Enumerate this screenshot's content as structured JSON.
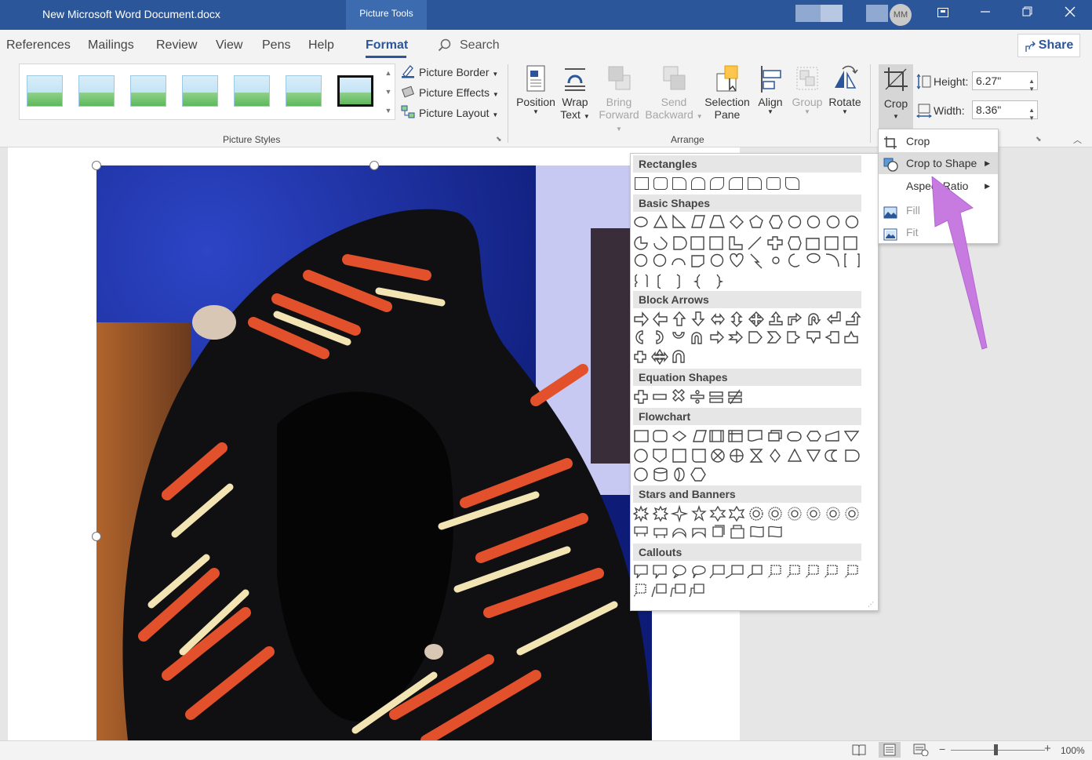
{
  "title_bar": {
    "doc_title": "New Microsoft Word Document.docx",
    "context_tab": "Picture Tools",
    "user_initials": "MM",
    "colors": {
      "bar": "#2b579a"
    }
  },
  "menu": {
    "tabs": [
      "References",
      "Mailings",
      "Review",
      "View",
      "Pens",
      "Help",
      "Format"
    ],
    "active_tab": "Format",
    "search_placeholder": "Search",
    "share_label": "Share"
  },
  "ribbon": {
    "picture_styles": {
      "label": "Picture Styles",
      "commands": [
        "Picture Border",
        "Picture Effects",
        "Picture Layout"
      ]
    },
    "arrange": {
      "label": "Arrange",
      "position": "Position",
      "wrap_text": [
        "Wrap",
        "Text"
      ],
      "bring_forward": [
        "Bring",
        "Forward"
      ],
      "send_backward": [
        "Send",
        "Backward"
      ],
      "selection_pane": [
        "Selection",
        "Pane"
      ],
      "align": "Align",
      "group": "Group",
      "rotate": "Rotate"
    },
    "size": {
      "crop": "Crop",
      "height_label": "Height:",
      "height_value": "6.27\"",
      "width_label": "Width:",
      "width_value": "8.36\""
    }
  },
  "crop_menu": {
    "items": [
      {
        "label": "Crop",
        "icon": "crop-icon",
        "submenu": false,
        "enabled": true
      },
      {
        "label": "Crop to Shape",
        "icon": "crop-to-shape-icon",
        "submenu": true,
        "enabled": true,
        "highlighted": true
      },
      {
        "label": "Aspect Ratio",
        "icon": "",
        "submenu": true,
        "enabled": true
      },
      {
        "label": "Fill",
        "icon": "fill-picture-icon",
        "submenu": false,
        "enabled": false
      },
      {
        "label": "Fit",
        "icon": "fit-picture-icon",
        "submenu": false,
        "enabled": false
      }
    ]
  },
  "shapes_panel": {
    "categories": [
      "Rectangles",
      "Basic Shapes",
      "Block Arrows",
      "Equation Shapes",
      "Flowchart",
      "Stars and Banners",
      "Callouts"
    ]
  },
  "status_bar": {
    "zoom": "100%"
  },
  "annotation": {
    "arrow_color": "#c77be0"
  }
}
